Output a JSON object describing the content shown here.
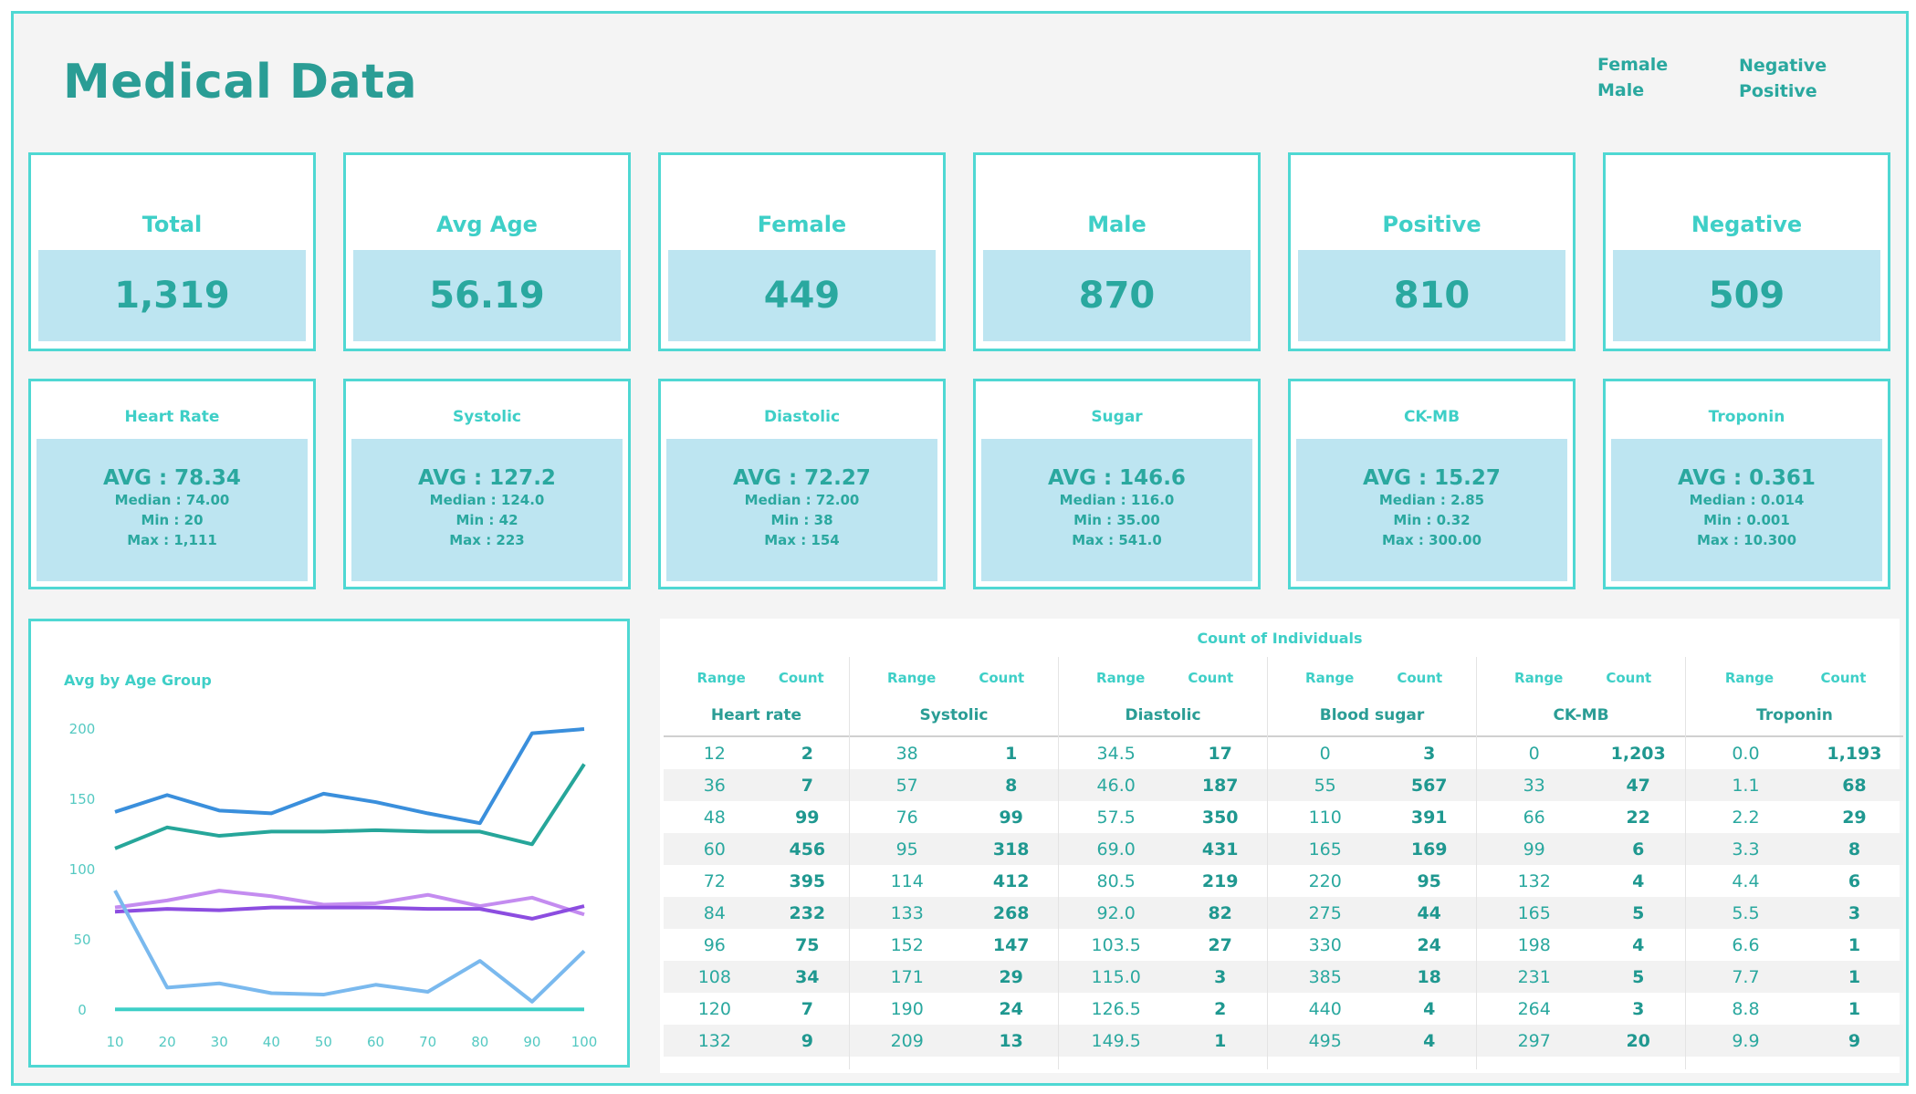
{
  "header": {
    "title": "Medical Data",
    "legend_gender": [
      "Female",
      "Male"
    ],
    "legend_result": [
      "Negative",
      "Positive"
    ]
  },
  "kpis": [
    {
      "label": "Total",
      "value": "1,319"
    },
    {
      "label": "Avg Age",
      "value": "56.19"
    },
    {
      "label": "Female",
      "value": "449"
    },
    {
      "label": "Male",
      "value": "870"
    },
    {
      "label": "Positive",
      "value": "810"
    },
    {
      "label": "Negative",
      "value": "509"
    }
  ],
  "stats": [
    {
      "label": "Heart Rate",
      "avg": "AVG : 78.34",
      "median": "Median : 74.00",
      "min": "Min : 20",
      "max": "Max : 1,111"
    },
    {
      "label": "Systolic",
      "avg": "AVG : 127.2",
      "median": "Median : 124.0",
      "min": "Min : 42",
      "max": "Max : 223"
    },
    {
      "label": "Diastolic",
      "avg": "AVG : 72.27",
      "median": "Median : 72.00",
      "min": "Min : 38",
      "max": "Max : 154"
    },
    {
      "label": "Sugar",
      "avg": "AVG : 146.6",
      "median": "Median : 116.0",
      "min": "Min : 35.00",
      "max": "Max : 541.0"
    },
    {
      "label": "CK-MB",
      "avg": "AVG : 15.27",
      "median": "Median : 2.85",
      "min": "Min : 0.32",
      "max": "Max : 300.00"
    },
    {
      "label": "Troponin",
      "avg": "AVG : 0.361",
      "median": "Median : 0.014",
      "min": "Min : 0.001",
      "max": "Max : 10.300"
    }
  ],
  "chart_data": {
    "type": "line",
    "title": "Avg by Age Group",
    "xlabel": "",
    "ylabel": "",
    "x": [
      10,
      20,
      30,
      40,
      50,
      60,
      70,
      80,
      90,
      100
    ],
    "ylim": [
      0,
      200
    ],
    "yticks": [
      0,
      50,
      100,
      150,
      200
    ],
    "grid": false,
    "series": [
      {
        "color": "#3a8fdc",
        "values": [
          141,
          153,
          142,
          140,
          154,
          148,
          140,
          133,
          197,
          200
        ]
      },
      {
        "color": "#26a69a",
        "values": [
          115,
          130,
          124,
          127,
          127,
          128,
          127,
          127,
          118,
          175
        ]
      },
      {
        "color": "#c48cf0",
        "values": [
          73,
          78,
          85,
          81,
          75,
          76,
          82,
          74,
          80,
          68
        ]
      },
      {
        "color": "#8c4de0",
        "values": [
          70,
          72,
          71,
          73,
          73,
          73,
          72,
          72,
          65,
          74
        ]
      },
      {
        "color": "#7ab9ee",
        "values": [
          85,
          16,
          19,
          12,
          11,
          18,
          13,
          35,
          6,
          42
        ]
      },
      {
        "color": "#3ecfc7",
        "values": [
          0.5,
          0.5,
          0.5,
          0.5,
          0.5,
          0.5,
          0.5,
          0.5,
          0.5,
          0.5
        ]
      }
    ]
  },
  "table": {
    "title": "Count of Individuals",
    "range_label": "Range",
    "count_label": "Count",
    "columns": [
      {
        "name": "Heart rate",
        "ranges": [
          "12",
          "36",
          "48",
          "60",
          "72",
          "84",
          "96",
          "108",
          "120",
          "132"
        ],
        "counts": [
          "2",
          "7",
          "99",
          "456",
          "395",
          "232",
          "75",
          "34",
          "7",
          "9"
        ]
      },
      {
        "name": "Systolic",
        "ranges": [
          "38",
          "57",
          "76",
          "95",
          "114",
          "133",
          "152",
          "171",
          "190",
          "209"
        ],
        "counts": [
          "1",
          "8",
          "99",
          "318",
          "412",
          "268",
          "147",
          "29",
          "24",
          "13"
        ]
      },
      {
        "name": "Diastolic",
        "ranges": [
          "34.5",
          "46.0",
          "57.5",
          "69.0",
          "80.5",
          "92.0",
          "103.5",
          "115.0",
          "126.5",
          "149.5"
        ],
        "counts": [
          "17",
          "187",
          "350",
          "431",
          "219",
          "82",
          "27",
          "3",
          "2",
          "1"
        ]
      },
      {
        "name": "Blood sugar",
        "ranges": [
          "0",
          "55",
          "110",
          "165",
          "220",
          "275",
          "330",
          "385",
          "440",
          "495"
        ],
        "counts": [
          "3",
          "567",
          "391",
          "169",
          "95",
          "44",
          "24",
          "18",
          "4",
          "4"
        ]
      },
      {
        "name": "CK-MB",
        "ranges": [
          "0",
          "33",
          "66",
          "99",
          "132",
          "165",
          "198",
          "231",
          "264",
          "297"
        ],
        "counts": [
          "1,203",
          "47",
          "22",
          "6",
          "4",
          "5",
          "4",
          "5",
          "3",
          "20"
        ]
      },
      {
        "name": "Troponin",
        "ranges": [
          "0.0",
          "1.1",
          "2.2",
          "3.3",
          "4.4",
          "5.5",
          "6.6",
          "7.7",
          "8.8",
          "9.9"
        ],
        "counts": [
          "1,193",
          "68",
          "29",
          "8",
          "6",
          "3",
          "1",
          "1",
          "1",
          "9"
        ]
      }
    ]
  }
}
